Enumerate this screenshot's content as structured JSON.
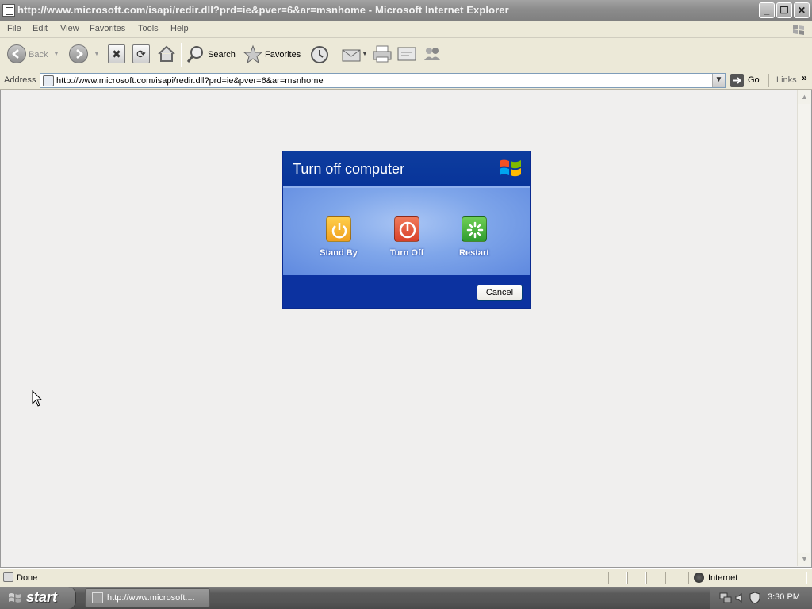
{
  "window": {
    "title": "http://www.microsoft.com/isapi/redir.dll?prd=ie&pver=6&ar=msnhome - Microsoft Internet Explorer"
  },
  "menu": [
    "File",
    "Edit",
    "View",
    "Favorites",
    "Tools",
    "Help"
  ],
  "toolbar": {
    "back_label": "Back",
    "search_label": "Search",
    "favorites_label": "Favorites"
  },
  "address": {
    "label": "Address",
    "url": "http://www.microsoft.com/isapi/redir.dll?prd=ie&pver=6&ar=msnhome",
    "go_label": "Go",
    "links_label": "Links"
  },
  "dialog": {
    "title": "Turn off computer",
    "options": [
      {
        "label": "Stand By",
        "icon": "standby-icon",
        "color": "#f0a020"
      },
      {
        "label": "Turn Off",
        "icon": "power-icon",
        "color": "#d8412a"
      },
      {
        "label": "Restart",
        "icon": "restart-icon",
        "color": "#2f9c2f"
      }
    ],
    "cancel_label": "Cancel"
  },
  "status": {
    "text": "Done",
    "zone": "Internet"
  },
  "taskbar": {
    "start_label": "start",
    "task_label": "http://www.microsoft....",
    "clock": "3:30 PM"
  }
}
